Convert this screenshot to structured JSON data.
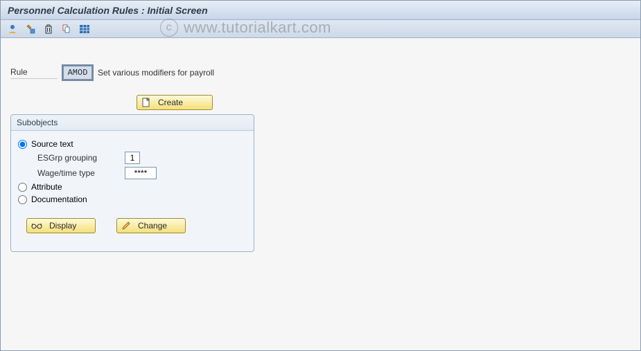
{
  "title": "Personnel Calculation Rules : Initial Screen",
  "watermark": "www.tutorialkart.com",
  "rule": {
    "label": "Rule",
    "value": "AMOD",
    "description": "Set various modifiers for payroll"
  },
  "buttons": {
    "create": "Create",
    "display": "Display",
    "change": "Change"
  },
  "subobjects": {
    "title": "Subobjects",
    "options": {
      "source_text": "Source text",
      "attribute": "Attribute",
      "documentation": "Documentation"
    },
    "selected": "source_text",
    "fields": {
      "esgrp_label": "ESGrp grouping",
      "esgrp_value": "1",
      "wage_label": "Wage/time type",
      "wage_value": "****"
    }
  },
  "toolbar_icons": [
    "person-icon",
    "copy-chain-icon",
    "delete-icon",
    "clipboard-icon",
    "grid-icon"
  ]
}
